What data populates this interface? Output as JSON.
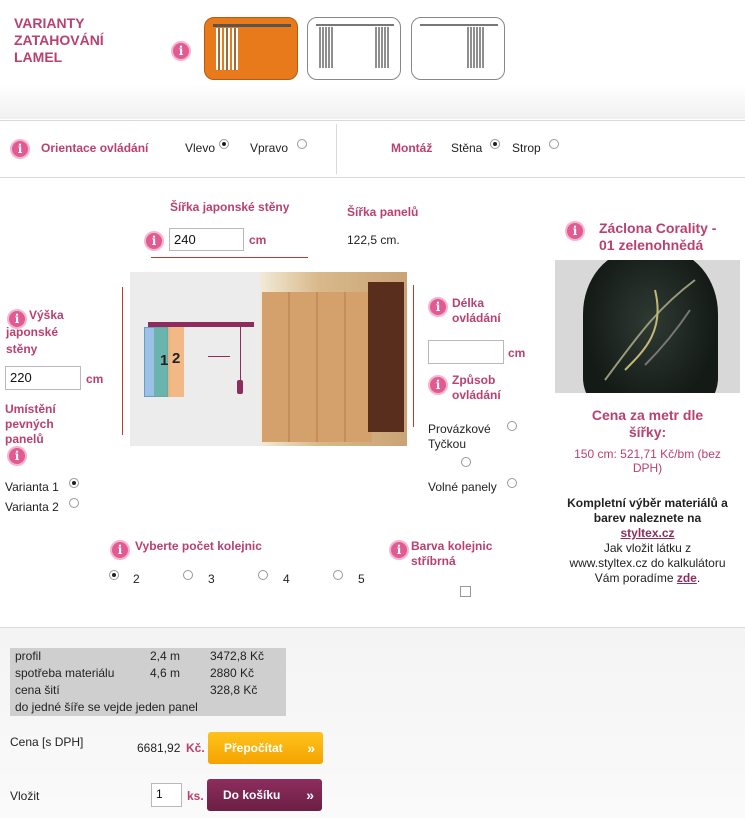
{
  "variants": {
    "title_line1": "VARIANTY",
    "title_line2": "ZATAHOVÁNÍ",
    "title_line3": "LAMEL",
    "accent": "#e87a1b"
  },
  "orientation": {
    "label": "Orientace ovládání",
    "left": "Vlevo",
    "right": "Vpravo",
    "selected": "Vlevo"
  },
  "mount": {
    "label": "Montáž",
    "wall": "Stěna",
    "ceiling": "Strop",
    "selected": "Stěna"
  },
  "width": {
    "label": "Šířka japonské stěny",
    "value": "240",
    "unit": "cm"
  },
  "panel_width": {
    "label": "Šířka panelů",
    "value": "122,5 cm."
  },
  "height": {
    "label_line1": "Výška",
    "label_line2": "japonské",
    "label_line3": "stěny",
    "value": "220",
    "unit": "cm"
  },
  "fixed_panels": {
    "label_line1": "Umístění",
    "label_line2": "pevných",
    "label_line3": "panelů",
    "option1": "Varianta 1",
    "option2": "Varianta 2",
    "selected": "Varianta 1"
  },
  "illustration": {
    "panel1": "1",
    "panel2": "2"
  },
  "control_length": {
    "label_line1": "Délka",
    "label_line2": "ovládání",
    "value": "",
    "unit": "cm"
  },
  "control_type": {
    "label_line1": "Způsob",
    "label_line2": "ovládání",
    "option1_line1": "Provázkové",
    "option1_line2": "Tyčkou",
    "option3": "Volné panely"
  },
  "rails": {
    "label": "Vyberte počet kolejnic",
    "options": [
      "2",
      "3",
      "4",
      "5"
    ],
    "selected": "2"
  },
  "rail_color": {
    "label_line1": "Barva kolejnic",
    "label_line2": "stříbrná"
  },
  "product": {
    "title_line1": "Záclona Corality -",
    "title_line2": "01 zelenohnědá",
    "price_title_line1": "Cena za metr dle",
    "price_title_line2": "šířky:",
    "price_line1": "150 cm: 521,71 Kč/bm (bez",
    "price_line2": "DPH)"
  },
  "promo": {
    "line1": "Kompletní výběr materiálů a",
    "line2": "barev naleznete na",
    "link": "styltex.cz",
    "line4": "Jak vložit látku z",
    "line5": "www.styltex.cz do kalkulátoru",
    "line6_pre": "Vám poradíme ",
    "line6_link": "zde",
    "line6_post": "."
  },
  "summary": {
    "rows": [
      {
        "name": "profil",
        "qty": "2,4 m",
        "price": "3472,8 Kč"
      },
      {
        "name": "spotřeba materiálu",
        "qty": "4,6 m",
        "price": "2880 Kč"
      },
      {
        "name": "cena šití",
        "qty": "",
        "price": "328,8 Kč"
      }
    ],
    "note": "do jedné šíře se vejde jeden panel"
  },
  "total": {
    "label": "Cena [s DPH]",
    "value": "6681,92",
    "currency": "Kč.",
    "button": "Přepočítat"
  },
  "cart": {
    "label": "Vložit",
    "qty": "1",
    "unit": "ks.",
    "button": "Do košíku"
  }
}
